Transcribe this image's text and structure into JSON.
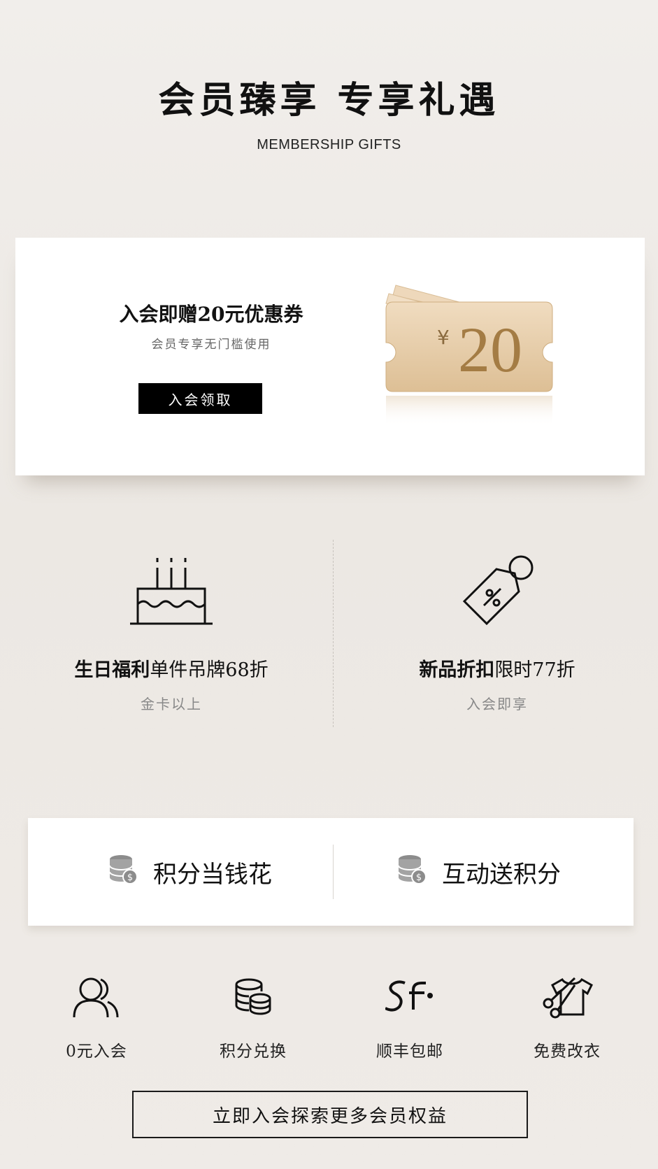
{
  "header": {
    "title": "会员臻享 专享礼遇",
    "subtitle": "MEMBERSHIP GIFTS"
  },
  "coupon_card": {
    "title": "入会即赠20元优惠券",
    "subtitle": "会员专享无门槛使用",
    "button_label": "入会领取",
    "coupon_currency": "¥",
    "coupon_amount": "20",
    "coupon_color": "#e3c6a0"
  },
  "benefits": [
    {
      "icon": "birthday-cake-icon",
      "title_bold": "生日福利",
      "title_rest": "单件吊牌68折",
      "subtitle": "金卡以上"
    },
    {
      "icon": "discount-tag-icon",
      "title_bold": "新品折扣",
      "title_rest": "限时77折",
      "subtitle": "入会即享"
    }
  ],
  "points_card": {
    "items": [
      {
        "icon": "coins-icon",
        "label": "积分当钱花"
      },
      {
        "icon": "coins-icon",
        "label": "互动送积分"
      }
    ]
  },
  "features": [
    {
      "icon": "users-icon",
      "label": "0元入会"
    },
    {
      "icon": "coin-stack-icon",
      "label": "积分兑换"
    },
    {
      "icon": "sf-logo-icon",
      "label": "顺丰包邮"
    },
    {
      "icon": "scissors-shirt-icon",
      "label": "免费改衣"
    }
  ],
  "cta": {
    "label": "立即入会探索更多会员权益"
  }
}
